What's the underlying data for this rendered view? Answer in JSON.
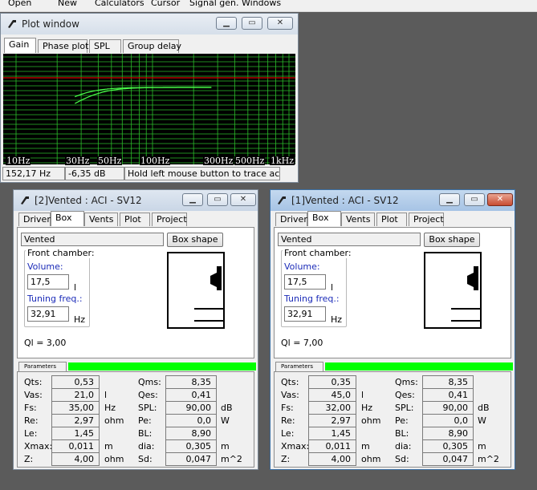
{
  "menu": [
    "Open",
    "New",
    "Calculators",
    "Cursor",
    "Signal gen.",
    "Windows"
  ],
  "plot_window": {
    "title": "Plot window",
    "tabs": [
      "Gain",
      "Phase plot",
      "SPL",
      "Group delay"
    ],
    "selected_tab": "Gain",
    "x_tick_labels": [
      "10Hz",
      "30Hz",
      "50Hz",
      "100Hz",
      "300Hz",
      "500Hz",
      "1kHz"
    ],
    "status": {
      "frequency": "152,17 Hz",
      "gain": "-6,35 dB",
      "hint": "Hold left mouse button to trace acti"
    },
    "colors": {
      "background": "#000000",
      "grid": "#2bbd2b",
      "reference_line": "#d40000",
      "curve": "#4aff4a"
    }
  },
  "box_windows": [
    {
      "title": "[2]Vented : ACI - SV12",
      "tabs": [
        "Driver",
        "Box",
        "Vents",
        "Plot",
        "Project"
      ],
      "selected_tab": "Box",
      "box_type": "Vented",
      "box_shape_label": "Box shape",
      "front_chamber_label": "Front chamber:",
      "volume_label": "Volume:",
      "volume": "17,5",
      "volume_unit": "l",
      "tuning_label": "Tuning freq.:",
      "tuning": "32,91",
      "tuning_unit": "Hz",
      "ql": "Ql = 3,00",
      "params_tab": "Parameters",
      "params_left": [
        {
          "label": "Qts:",
          "value": "0,53",
          "unit": ""
        },
        {
          "label": "Vas:",
          "value": "21,0",
          "unit": "l"
        },
        {
          "label": "Fs:",
          "value": "35,00",
          "unit": "Hz"
        },
        {
          "label": "Re:",
          "value": "2,97",
          "unit": "ohm"
        },
        {
          "label": "Le:",
          "value": "1,45",
          "unit": ""
        },
        {
          "label": "Xmax:",
          "value": "0,011",
          "unit": "m"
        },
        {
          "label": "Z:",
          "value": "4,00",
          "unit": "ohm"
        }
      ],
      "params_right": [
        {
          "label": "Qms:",
          "value": "8,35",
          "unit": ""
        },
        {
          "label": "Qes:",
          "value": "0,41",
          "unit": ""
        },
        {
          "label": "SPL:",
          "value": "90,00",
          "unit": "dB"
        },
        {
          "label": "Pe:",
          "value": "0,0",
          "unit": "W"
        },
        {
          "label": "BL:",
          "value": "8,90",
          "unit": ""
        },
        {
          "label": "dia:",
          "value": "0,305",
          "unit": "m"
        },
        {
          "label": "Sd:",
          "value": "0,047",
          "unit": "m^2"
        }
      ]
    },
    {
      "title": "[1]Vented : ACI - SV12",
      "tabs": [
        "Driver",
        "Box",
        "Vents",
        "Plot",
        "Project"
      ],
      "selected_tab": "Box",
      "box_type": "Vented",
      "box_shape_label": "Box shape",
      "front_chamber_label": "Front chamber:",
      "volume_label": "Volume:",
      "volume": "17,5",
      "volume_unit": "l",
      "tuning_label": "Tuning freq.:",
      "tuning": "32,91",
      "tuning_unit": "Hz",
      "ql": "Ql = 7,00",
      "params_tab": "Parameters",
      "params_left": [
        {
          "label": "Qts:",
          "value": "0,35",
          "unit": ""
        },
        {
          "label": "Vas:",
          "value": "45,0",
          "unit": "l"
        },
        {
          "label": "Fs:",
          "value": "32,00",
          "unit": "Hz"
        },
        {
          "label": "Re:",
          "value": "2,97",
          "unit": "ohm"
        },
        {
          "label": "Le:",
          "value": "1,45",
          "unit": ""
        },
        {
          "label": "Xmax:",
          "value": "0,011",
          "unit": "m"
        },
        {
          "label": "Z:",
          "value": "4,00",
          "unit": "ohm"
        }
      ],
      "params_right": [
        {
          "label": "Qms:",
          "value": "8,35",
          "unit": ""
        },
        {
          "label": "Qes:",
          "value": "0,41",
          "unit": ""
        },
        {
          "label": "SPL:",
          "value": "90,00",
          "unit": "dB"
        },
        {
          "label": "Pe:",
          "value": "0,0",
          "unit": "W"
        },
        {
          "label": "BL:",
          "value": "8,90",
          "unit": ""
        },
        {
          "label": "dia:",
          "value": "0,305",
          "unit": "m"
        },
        {
          "label": "Sd:",
          "value": "0,047",
          "unit": "m^2"
        }
      ]
    }
  ]
}
